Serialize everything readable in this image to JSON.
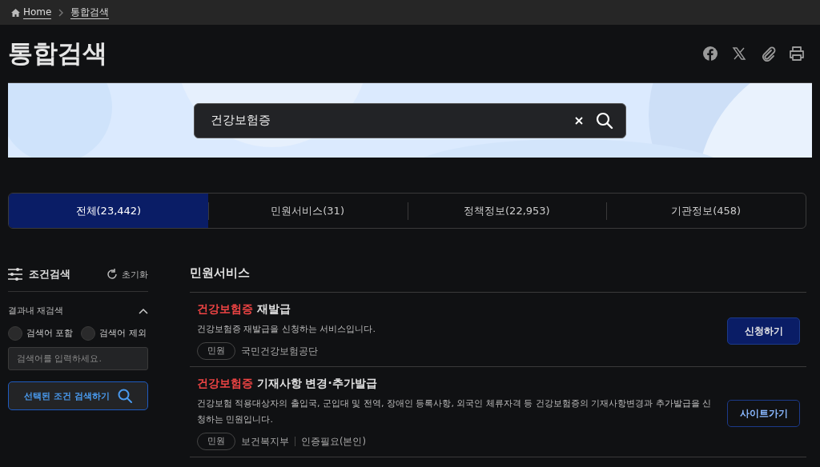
{
  "breadcrumb": [
    {
      "label": "Home",
      "kind": "home"
    },
    {
      "label": "통합검색",
      "kind": "page"
    }
  ],
  "page_title": "통합검색",
  "share_icons": [
    {
      "kind": "facebook"
    },
    {
      "kind": "x"
    },
    {
      "kind": "link"
    },
    {
      "kind": "print"
    }
  ],
  "search": {
    "value": "건강보험증"
  },
  "tabs": [
    {
      "label": "전체(23,442)",
      "selected": true
    },
    {
      "label": "민원서비스(31)",
      "selected": false
    },
    {
      "label": "정책정보(22,953)",
      "selected": false
    },
    {
      "label": "기관정보(458)",
      "selected": false
    }
  ],
  "sidebar": {
    "title": "조건검색",
    "reset": "초기화",
    "section": {
      "title": "결과내 재검색",
      "expanded": true,
      "options": [
        {
          "label": "검색어 포함",
          "selected": false
        },
        {
          "label": "검색어 제외",
          "selected": false
        }
      ],
      "placeholder": "검색어를 입력하세요.",
      "submit": "선택된 조건 검색하기"
    }
  },
  "section_title": "민원서비스",
  "results": [
    {
      "keyword": "건강보험증",
      "title": "재발급",
      "description": "건강보험증 재발급을 신청하는 서비스입니다.",
      "tag": "민원",
      "meta": [
        "국민건강보험공단"
      ],
      "button": {
        "label": "신청하기",
        "kind": "primary"
      }
    },
    {
      "keyword": "건강보험증",
      "title": "기재사항 변경·추가발급",
      "description": "건강보험 적용대상자의 출입국, 군입대 및 전역, 장애인 등록사항, 외국인 체류자격 등 건강보험증의 기재사항변경과 추가발급을 신청하는 민원입니다.",
      "tag": "민원",
      "meta": [
        "보건복지부",
        "인증필요(본인)"
      ],
      "button": {
        "label": "사이트가기",
        "kind": "outline"
      }
    }
  ]
}
